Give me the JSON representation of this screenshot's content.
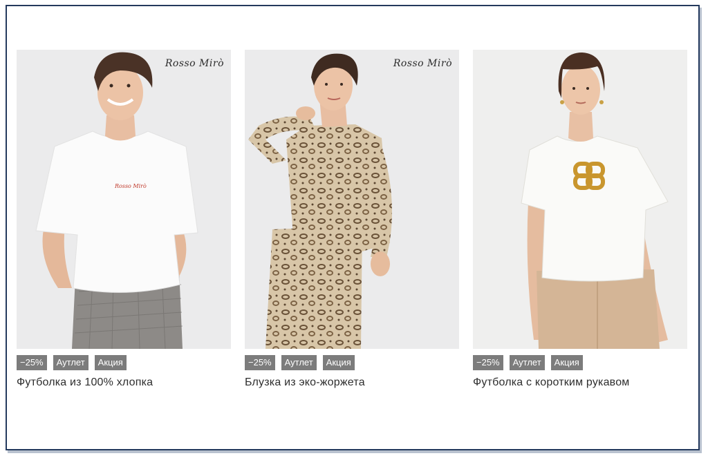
{
  "products": [
    {
      "brand": "Rosso Mirò",
      "badges": [
        "−25%",
        "Аутлет",
        "Акция"
      ],
      "title": "Футболка из 100% хлопка",
      "image_desc": "woman-white-tshirt-plaid-trousers"
    },
    {
      "brand": "Rosso Mirò",
      "badges": [
        "−25%",
        "Аутлет",
        "Акция"
      ],
      "title": "Блузка из эко-жоржета",
      "image_desc": "woman-leopard-print-blouse"
    },
    {
      "brand": "",
      "badges": [
        "−25%",
        "Аутлет",
        "Акция"
      ],
      "title": "Футболка с коротким рукавом",
      "image_desc": "woman-white-tshirt-gold-chain-beige-trousers"
    }
  ],
  "chest_logo_text": "Rosso Mirò",
  "colors": {
    "frame_border": "#23395d",
    "badge_bg": "#7c7c7c",
    "badge_text": "#ffffff",
    "title_text": "#2d2d2d",
    "photo_bg": "#ececed"
  }
}
